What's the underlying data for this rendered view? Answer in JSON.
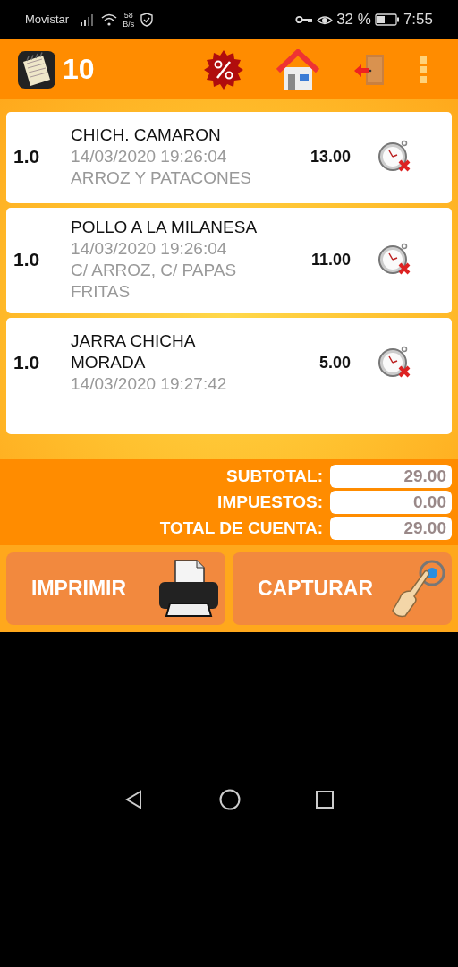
{
  "status_bar": {
    "carrier": "Movistar",
    "speed_value": "58",
    "speed_unit": "B/s",
    "battery": "32 %",
    "time": "7:55"
  },
  "header": {
    "table_number": "10"
  },
  "items": [
    {
      "quantity": "1.0",
      "name": "CHICH. CAMARON",
      "time": "14/03/2020 19:26:04",
      "note": "ARROZ Y PATACONES",
      "price": "13.00"
    },
    {
      "quantity": "1.0",
      "name": "POLLO A LA MILANESA",
      "time": "14/03/2020 19:26:04",
      "note": "C/ ARROZ, C/ PAPAS FRITAS",
      "price": "11.00"
    },
    {
      "quantity": "1.0",
      "name": "JARRA CHICHA MORADA",
      "time": "14/03/2020 19:27:42",
      "price": "5.00"
    }
  ],
  "totals": [
    {
      "label": "SUBTOTAL:",
      "value": "29.00"
    },
    {
      "label": "IMPUESTOS:",
      "value": "0.00"
    },
    {
      "label": "TOTAL DE CUENTA:",
      "value": "29.00"
    }
  ],
  "buttons": [
    {
      "kind": "print",
      "label": "IMPRIMIR"
    },
    {
      "kind": "capture",
      "label": "CAPTURAR"
    }
  ]
}
